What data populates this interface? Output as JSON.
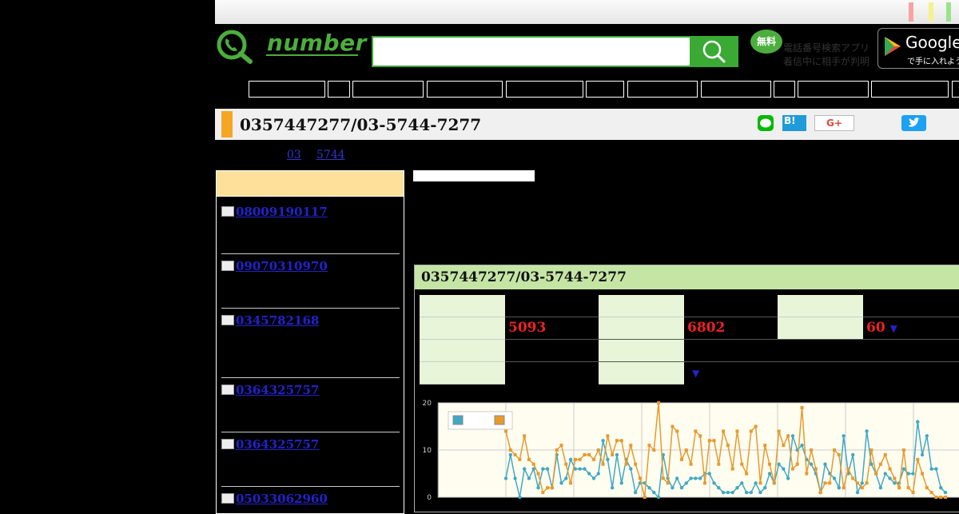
{
  "header": {
    "logo_text": "number",
    "search": {
      "value": "",
      "placeholder": ""
    },
    "free_badge": "無料",
    "app_promo_line1": "電話番号検索アプリ",
    "app_promo_line2": "着信中に相手が判明",
    "store_name": "Google",
    "store_sub": "で手に入れよう",
    "brand_color": "#3aaa35"
  },
  "page": {
    "title": "0357447277/03-5744-7277",
    "breadcrumbs": [
      "",
      "",
      "03",
      "5744"
    ]
  },
  "share": {
    "hatena": "B!",
    "gplus": "G+"
  },
  "sidebar": {
    "items": [
      {
        "label": "08009190117"
      },
      {
        "label": "09070310970"
      },
      {
        "label": "0345782168"
      },
      {
        "label": "0364325757"
      },
      {
        "label": "0364325757"
      },
      {
        "label": "05033062960"
      }
    ]
  },
  "stats": {
    "title": "0357447277/03-5744-7277",
    "value_1": "5093",
    "value_2": "6802",
    "value_3": "60",
    "arrow": "▼"
  },
  "chart_data": {
    "type": "line",
    "ylim": [
      0,
      20
    ],
    "yticks": [
      "0",
      "10",
      "20"
    ],
    "grid": true,
    "legend": "top-left",
    "colors": [
      "#3fa9c5",
      "#e79a2e"
    ],
    "series": [
      {
        "values": [
          4,
          9,
          4,
          0,
          6,
          4,
          6,
          2,
          6,
          6,
          2,
          9,
          3,
          4,
          8,
          6,
          6,
          6,
          5,
          4,
          5,
          12,
          8,
          2,
          9,
          3,
          8,
          6,
          1,
          3,
          3,
          2,
          1,
          0,
          9,
          4,
          2,
          4,
          2,
          3,
          4,
          4,
          4,
          5,
          5,
          3,
          2,
          1,
          1,
          1,
          2,
          3,
          1,
          1,
          3,
          1,
          2,
          5,
          3,
          7,
          6,
          4,
          13,
          10,
          11,
          8,
          7,
          5,
          1,
          7,
          5,
          4,
          2,
          13,
          5,
          9,
          1,
          3,
          14,
          7,
          5,
          2,
          5,
          4,
          3,
          3,
          6,
          5,
          5,
          16,
          9,
          13,
          6,
          6,
          2,
          1
        ]
      },
      {
        "values": [
          14,
          10,
          9,
          8,
          13,
          8,
          7,
          5,
          1,
          2,
          2,
          10,
          11,
          7,
          3,
          8,
          8,
          9,
          9,
          8,
          10,
          7,
          13,
          9,
          12,
          12,
          7,
          11,
          7,
          4,
          0,
          11,
          10,
          20,
          4,
          3,
          15,
          14,
          8,
          10,
          7,
          14,
          13,
          3,
          12,
          12,
          7,
          14,
          11,
          6,
          14,
          7,
          5,
          14,
          15,
          3,
          11,
          7,
          3,
          14,
          11,
          13,
          6,
          7,
          19,
          5,
          10,
          6,
          1,
          3,
          3,
          10,
          9,
          2,
          6,
          4,
          3,
          2,
          3,
          10,
          5,
          7,
          9,
          6,
          4,
          2,
          10,
          2,
          1,
          8,
          5,
          2,
          1,
          0,
          0,
          0
        ]
      }
    ]
  }
}
